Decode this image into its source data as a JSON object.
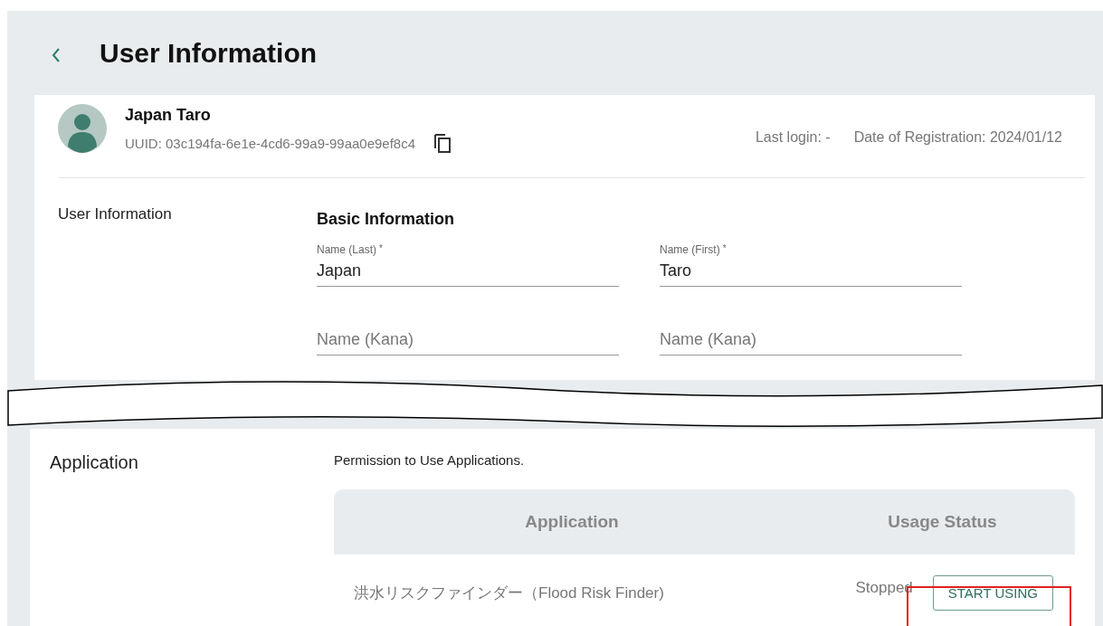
{
  "header": {
    "title": "User Information"
  },
  "profile": {
    "name": "Japan Taro",
    "uuid": "UUID: 03c194fa-6e1e-4cd6-99a9-99aa0e9ef8c4",
    "last_login": "Last login: -",
    "registration": "Date of Registration: 2024/01/12"
  },
  "user_section": {
    "label": "User Information",
    "heading": "Basic Information",
    "fields": [
      {
        "label": "Name (Last)",
        "required_mark": "*",
        "value": "Japan"
      },
      {
        "label": "Name (First)",
        "required_mark": "*",
        "value": "Taro"
      },
      {
        "placeholder": "Name (Kana)"
      },
      {
        "placeholder": "Name (Kana)"
      }
    ]
  },
  "application_section": {
    "label": "Application",
    "description": "Permission to Use Applications.",
    "table": {
      "columns": [
        "Application",
        "Usage Status"
      ],
      "rows": [
        {
          "application": "洪水リスクファインダー（Flood Risk Finder)",
          "status": "Stopped",
          "button": "START USING",
          "highlighted": true
        }
      ]
    }
  }
}
